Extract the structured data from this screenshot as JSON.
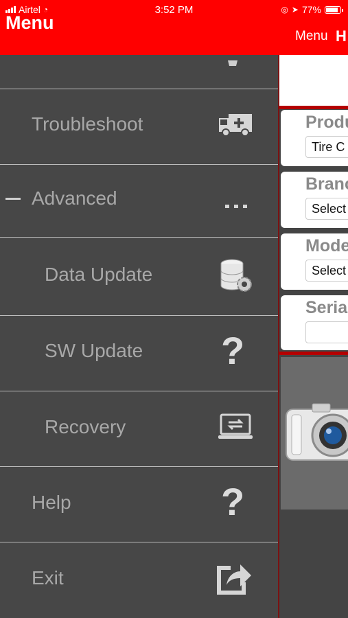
{
  "status_bar": {
    "carrier": "Airtel",
    "time": "3:52 PM",
    "battery": "77%"
  },
  "header": {
    "title": "Menu",
    "right_menu": "Menu",
    "right_partial": "H"
  },
  "side_menu": {
    "items": [
      {
        "label": "Troubleshoot",
        "icon": "ambulance-icon"
      },
      {
        "label": "Advanced",
        "icon": "ellipsis-icon"
      },
      {
        "label": "Data Update",
        "icon": "database-gear-icon"
      },
      {
        "label": "SW Update",
        "icon": "question-icon"
      },
      {
        "label": "Recovery",
        "icon": "laptop-sync-icon"
      },
      {
        "label": "Help",
        "icon": "question-icon"
      },
      {
        "label": "Exit",
        "icon": "share-exit-icon"
      }
    ]
  },
  "form": {
    "product_label": "Produ",
    "product_value": "Tire C",
    "brand_label": "Branc",
    "brand_value": "Select",
    "model_label": "Mode",
    "model_value": "Select",
    "serial_label": "Seria",
    "serial_value": ""
  },
  "colors": {
    "header_red": "#ff0000",
    "menu_bg": "#474747",
    "menu_text": "#a8a8a8"
  }
}
